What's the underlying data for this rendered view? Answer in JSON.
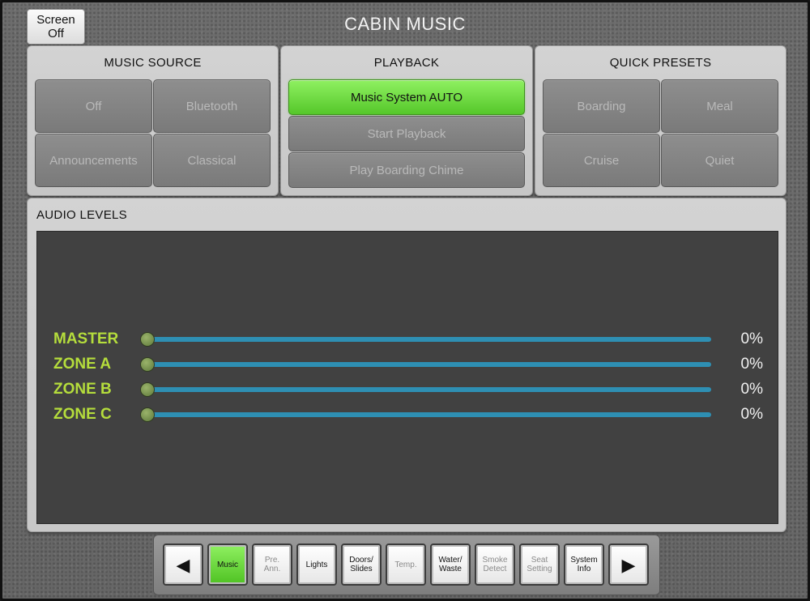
{
  "screen_off": {
    "line1": "Screen",
    "line2": "Off"
  },
  "title": "CABIN MUSIC",
  "music_source": {
    "title": "MUSIC SOURCE",
    "buttons": [
      "Off",
      "Bluetooth",
      "Announcements",
      "Classical"
    ]
  },
  "playback": {
    "title": "PLAYBACK",
    "buttons": [
      "Music System AUTO",
      "Start Playback",
      "Play Boarding Chime"
    ],
    "active_index": 0
  },
  "quick_presets": {
    "title": "QUICK PRESETS",
    "buttons": [
      "Boarding",
      "Meal",
      "Cruise",
      "Quiet"
    ]
  },
  "audio_levels": {
    "title": "AUDIO LEVELS",
    "channels": [
      {
        "label": "MASTER",
        "value_text": "0%",
        "level": 0
      },
      {
        "label": "ZONE A",
        "value_text": "0%",
        "level": 0
      },
      {
        "label": "ZONE B",
        "value_text": "0%",
        "level": 0
      },
      {
        "label": "ZONE C",
        "value_text": "0%",
        "level": 0
      }
    ]
  },
  "nav": {
    "prev_icon": "left-arrow-icon",
    "next_icon": "right-arrow-icon",
    "items": [
      {
        "label": "Music",
        "active": true,
        "dim": false
      },
      {
        "label": "Pre.\nAnn.",
        "active": false,
        "dim": true
      },
      {
        "label": "Lights",
        "active": false,
        "dim": false
      },
      {
        "label": "Doors/\nSlides",
        "active": false,
        "dim": false
      },
      {
        "label": "Temp.",
        "active": false,
        "dim": true
      },
      {
        "label": "Water/\nWaste",
        "active": false,
        "dim": false
      },
      {
        "label": "Smoke\nDetect",
        "active": false,
        "dim": true
      },
      {
        "label": "Seat\nSetting",
        "active": false,
        "dim": true
      },
      {
        "label": "System\nInfo",
        "active": false,
        "dim": false
      }
    ]
  },
  "colors": {
    "accent_green": "#55c72a",
    "level_label": "#b5dd3c",
    "slider_track": "#2e8fb3"
  }
}
